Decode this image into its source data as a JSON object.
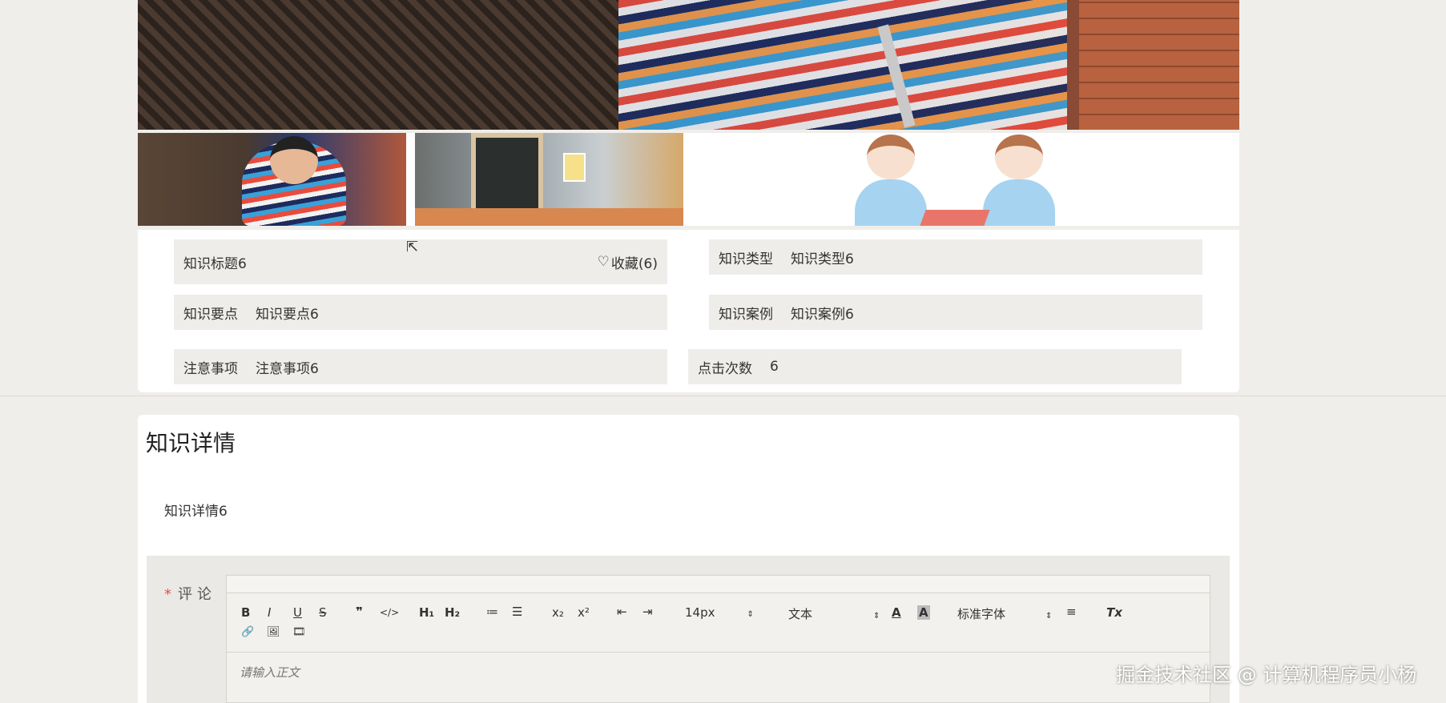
{
  "info": {
    "title": "知识标题6",
    "favorite_label": "收藏(6)",
    "type_label": "知识类型",
    "type_value": "知识类型6",
    "points_label": "知识要点",
    "points_value": "知识要点6",
    "case_label": "知识案例",
    "case_value": "知识案例6",
    "notes_label": "注意事项",
    "notes_value": "注意事项6",
    "clicks_label": "点击次数",
    "clicks_value": "6"
  },
  "details": {
    "heading": "知识详情",
    "content": "知识详情6"
  },
  "comment": {
    "required_mark": "*",
    "label": "评论",
    "placeholder": "请输入正文"
  },
  "toolbar": {
    "bold": "B",
    "italic": "I",
    "underline": "U",
    "strike": "S",
    "quote": "❞",
    "code": "</>",
    "h1": "H₁",
    "h2": "H₂",
    "ordered_list": "≔",
    "bullet_list": "☰",
    "subscript": "x₂",
    "superscript": "x²",
    "outdent": "⇤",
    "indent": "⇥",
    "font_size": "14px",
    "header_select": "文本",
    "font_color": "A",
    "bg_color": "A",
    "font_family": "标准字体",
    "align": "≡",
    "clean": "Tx",
    "link": "🔗",
    "image": "🖼",
    "video": "🎞"
  },
  "watermark": "掘金技术社区 @ 计算机程序员小杨",
  "colors": {
    "page_bg": "#f0eeea",
    "field_bg": "#efede9",
    "required": "#e05050"
  }
}
